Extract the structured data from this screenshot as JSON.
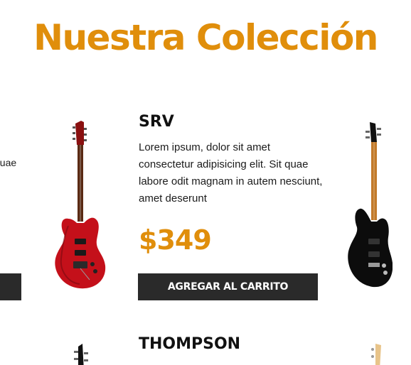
{
  "section": {
    "title": "Nuestra Colección"
  },
  "carousel": {
    "prev_card": {
      "text_fragment": "quae"
    },
    "current_card": {
      "name": "SRV",
      "description": "Lorem ipsum, dolor sit amet consectetur adipisicing elit. Sit quae labore odit magnam in autem nesciunt, amet deserunt",
      "price": "$349",
      "button_label": "AGREGAR AL CARRITO",
      "image_icon": "red-electric-guitar"
    },
    "next_card": {
      "image_icon": "black-electric-guitar"
    }
  },
  "next_row": {
    "name": "THOMPSON",
    "image_icon_left": "black-guitar-headstock",
    "image_icon_right": "natural-guitar-headstock"
  },
  "colors": {
    "accent": "#e08e0b",
    "button_bg": "#2a2a2a",
    "button_text": "#ffffff",
    "text": "#1b1b1b"
  }
}
